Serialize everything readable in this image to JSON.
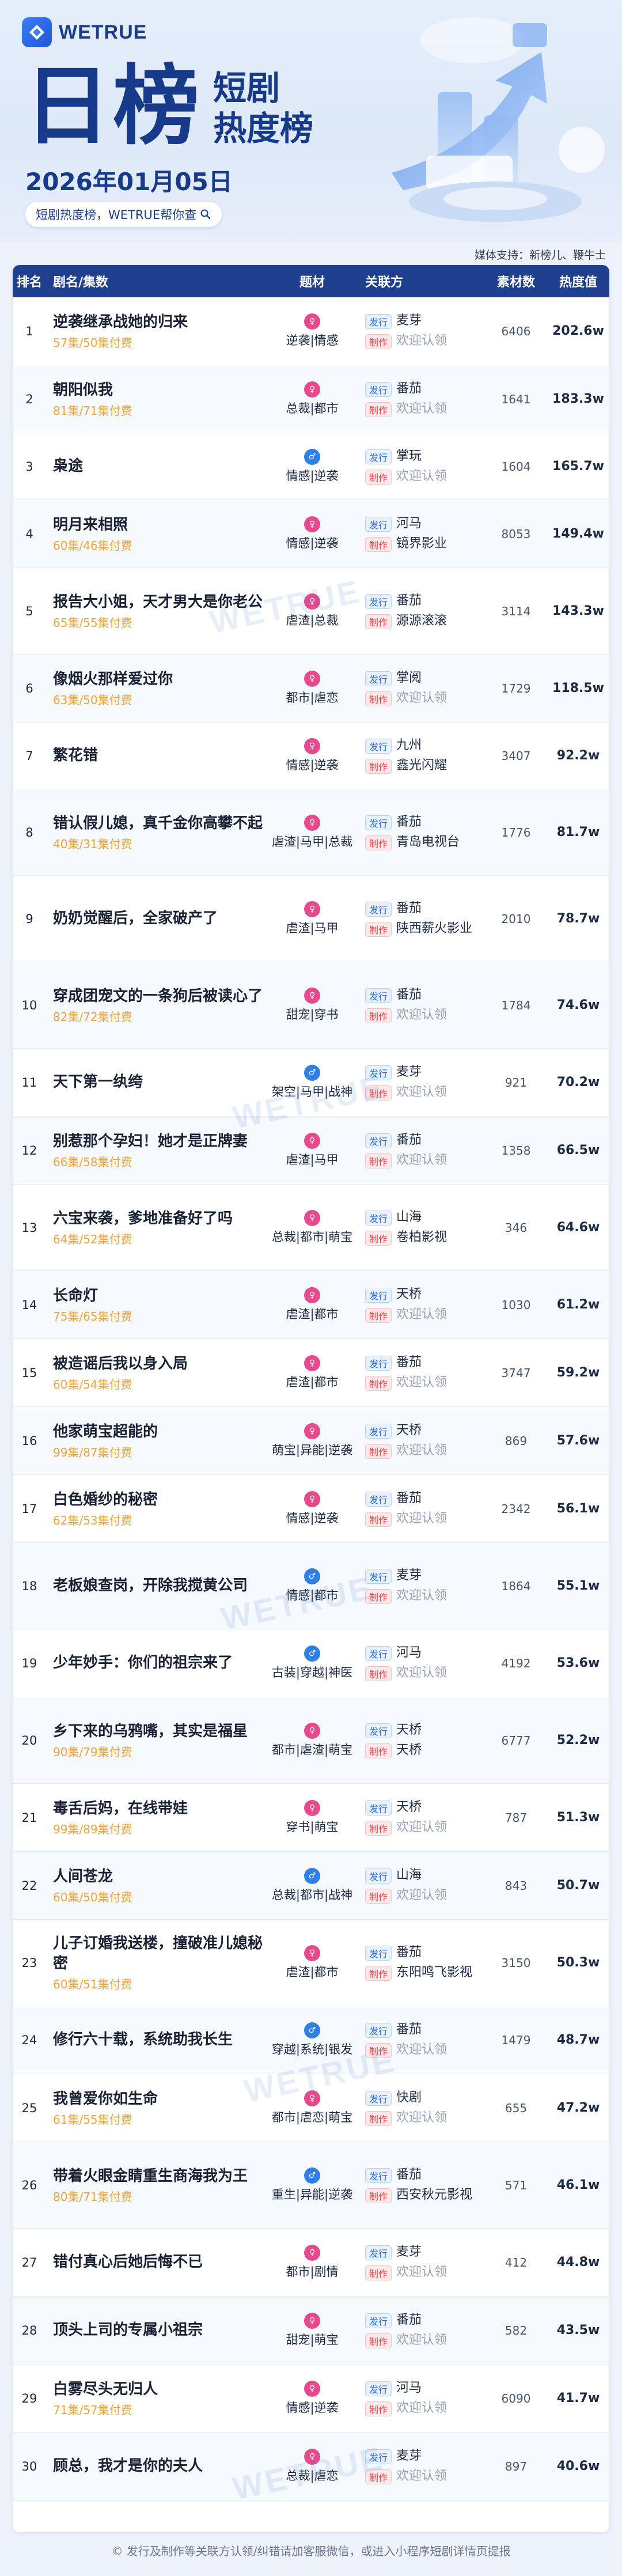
{
  "brand": "WETRUE",
  "header": {
    "title": "日榜",
    "side_line1": "短剧",
    "side_line2": "热度榜",
    "date": "2026年01月05日",
    "slogan": "短剧热度榜，WETRUE帮你查"
  },
  "sponsor": "媒体支持：新榜儿、鞭牛士",
  "columns": {
    "rank": "排名",
    "title": "剧名/集数",
    "tag": "题材",
    "assoc": "关联方",
    "num": "素材数",
    "heat": "热度值"
  },
  "badges": {
    "publish": "发行",
    "produce": "制作"
  },
  "watermark": "WETRUE",
  "colors": {
    "header_bg": "#1f3f8f",
    "accent": "#2f6fe3",
    "episode": "#f2a33a",
    "produce_badge": "#e5484d"
  },
  "rows": [
    {
      "rank": "1",
      "name": "逆袭继承战她的归来",
      "ep": "57集/50集付费",
      "tag": "逆袭|情感",
      "icon": "pink",
      "publish": "麦芽",
      "produce": "欢迎认领",
      "claim": true,
      "num": "6406",
      "heat": "202.6w"
    },
    {
      "rank": "2",
      "name": "朝阳似我",
      "ep": "81集/71集付费",
      "tag": "总裁|都市",
      "icon": "pink",
      "publish": "番茄",
      "produce": "欢迎认领",
      "claim": true,
      "num": "1641",
      "heat": "183.3w"
    },
    {
      "rank": "3",
      "name": "枭途",
      "ep": "",
      "tag": "情感|逆袭",
      "icon": "blue",
      "publish": "掌玩",
      "produce": "欢迎认领",
      "claim": true,
      "num": "1604",
      "heat": "165.7w"
    },
    {
      "rank": "4",
      "name": "明月来相照",
      "ep": "60集/46集付费",
      "tag": "情感|逆袭",
      "icon": "pink",
      "publish": "河马",
      "produce": "镜界影业",
      "claim": false,
      "num": "8053",
      "heat": "149.4w"
    },
    {
      "rank": "5",
      "name": "报告大小姐，天才男大是你老公",
      "ep": "65集/55集付费",
      "tag": "虐渣|总裁",
      "icon": "pink",
      "publish": "番茄",
      "produce": "源源滚滚",
      "claim": false,
      "num": "3114",
      "heat": "143.3w"
    },
    {
      "rank": "6",
      "name": "像烟火那样爱过你",
      "ep": "63集/50集付费",
      "tag": "都市|虐恋",
      "icon": "pink",
      "publish": "掌阅",
      "produce": "欢迎认领",
      "claim": true,
      "num": "1729",
      "heat": "118.5w"
    },
    {
      "rank": "7",
      "name": "繁花错",
      "ep": "",
      "tag": "情感|逆袭",
      "icon": "pink",
      "publish": "九州",
      "produce": "鑫光闪耀",
      "claim": false,
      "num": "3407",
      "heat": "92.2w"
    },
    {
      "rank": "8",
      "name": "错认假儿媳，真千金你高攀不起",
      "ep": "40集/31集付费",
      "tag": "虐渣|马甲|总裁",
      "icon": "pink",
      "publish": "番茄",
      "produce": "青岛电视台",
      "claim": false,
      "num": "1776",
      "heat": "81.7w"
    },
    {
      "rank": "9",
      "name": "奶奶觉醒后，全家破产了",
      "ep": "",
      "tag": "虐渣|马甲",
      "icon": "pink",
      "publish": "番茄",
      "produce": "陕西薪火影业",
      "claim": false,
      "num": "2010",
      "heat": "78.7w"
    },
    {
      "rank": "10",
      "name": "穿成团宠文的一条狗后被读心了",
      "ep": "82集/72集付费",
      "tag": "甜宠|穿书",
      "icon": "pink",
      "publish": "番茄",
      "produce": "欢迎认领",
      "claim": true,
      "num": "1784",
      "heat": "74.6w"
    },
    {
      "rank": "11",
      "name": "天下第一纨绔",
      "ep": "",
      "tag": "架空|马甲|战神",
      "icon": "blue",
      "publish": "麦芽",
      "produce": "欢迎认领",
      "claim": true,
      "num": "921",
      "heat": "70.2w"
    },
    {
      "rank": "12",
      "name": "别惹那个孕妇！她才是正牌妻",
      "ep": "66集/58集付费",
      "tag": "虐渣|马甲",
      "icon": "pink",
      "publish": "番茄",
      "produce": "欢迎认领",
      "claim": true,
      "num": "1358",
      "heat": "66.5w"
    },
    {
      "rank": "13",
      "name": "六宝来袭，爹地准备好了吗",
      "ep": "64集/52集付费",
      "tag": "总裁|都市|萌宝",
      "icon": "pink",
      "publish": "山海",
      "produce": "卷柏影视",
      "claim": false,
      "num": "346",
      "heat": "64.6w"
    },
    {
      "rank": "14",
      "name": "长命灯",
      "ep": "75集/65集付费",
      "tag": "虐渣|都市",
      "icon": "pink",
      "publish": "天桥",
      "produce": "欢迎认领",
      "claim": true,
      "num": "1030",
      "heat": "61.2w"
    },
    {
      "rank": "15",
      "name": "被造谣后我以身入局",
      "ep": "60集/54集付费",
      "tag": "虐渣|都市",
      "icon": "pink",
      "publish": "番茄",
      "produce": "欢迎认领",
      "claim": true,
      "num": "3747",
      "heat": "59.2w"
    },
    {
      "rank": "16",
      "name": "他家萌宝超能的",
      "ep": "99集/87集付费",
      "tag": "萌宝|异能|逆袭",
      "icon": "pink",
      "publish": "天桥",
      "produce": "欢迎认领",
      "claim": true,
      "num": "869",
      "heat": "57.6w"
    },
    {
      "rank": "17",
      "name": "白色婚纱的秘密",
      "ep": "62集/53集付费",
      "tag": "情感|逆袭",
      "icon": "pink",
      "publish": "番茄",
      "produce": "欢迎认领",
      "claim": true,
      "num": "2342",
      "heat": "56.1w"
    },
    {
      "rank": "18",
      "name": "老板娘查岗，开除我搅黄公司",
      "ep": "",
      "tag": "情感|都市",
      "icon": "blue",
      "publish": "麦芽",
      "produce": "欢迎认领",
      "claim": true,
      "num": "1864",
      "heat": "55.1w"
    },
    {
      "rank": "19",
      "name": "少年妙手：你们的祖宗来了",
      "ep": "",
      "tag": "古装|穿越|神医",
      "icon": "blue",
      "publish": "河马",
      "produce": "欢迎认领",
      "claim": true,
      "num": "4192",
      "heat": "53.6w"
    },
    {
      "rank": "20",
      "name": "乡下来的乌鸦嘴，其实是福星",
      "ep": "90集/79集付费",
      "tag": "都市|虐渣|萌宝",
      "icon": "pink",
      "publish": "天桥",
      "produce": "天桥",
      "claim": false,
      "num": "6777",
      "heat": "52.2w"
    },
    {
      "rank": "21",
      "name": "毒舌后妈，在线带娃",
      "ep": "99集/89集付费",
      "tag": "穿书|萌宝",
      "icon": "pink",
      "publish": "天桥",
      "produce": "欢迎认领",
      "claim": true,
      "num": "787",
      "heat": "51.3w"
    },
    {
      "rank": "22",
      "name": "人间苍龙",
      "ep": "60集/50集付费",
      "tag": "总裁|都市|战神",
      "icon": "blue",
      "publish": "山海",
      "produce": "欢迎认领",
      "claim": true,
      "num": "843",
      "heat": "50.7w"
    },
    {
      "rank": "23",
      "name": "儿子订婚我送楼，撞破准儿媳秘密",
      "ep": "60集/51集付费",
      "tag": "虐渣|都市",
      "icon": "pink",
      "publish": "番茄",
      "produce": "东阳鸣飞影视",
      "claim": false,
      "num": "3150",
      "heat": "50.3w"
    },
    {
      "rank": "24",
      "name": "修行六十载，系统助我长生",
      "ep": "",
      "tag": "穿越|系统|银发",
      "icon": "blue",
      "publish": "番茄",
      "produce": "欢迎认领",
      "claim": true,
      "num": "1479",
      "heat": "48.7w"
    },
    {
      "rank": "25",
      "name": "我曾爱你如生命",
      "ep": "61集/55集付费",
      "tag": "都市|虐恋|萌宝",
      "icon": "pink",
      "publish": "快剧",
      "produce": "欢迎认领",
      "claim": true,
      "num": "655",
      "heat": "47.2w"
    },
    {
      "rank": "26",
      "name": "带着火眼金睛重生商海我为王",
      "ep": "80集/71集付费",
      "tag": "重生|异能|逆袭",
      "icon": "blue",
      "publish": "番茄",
      "produce": "西安秋元影视",
      "claim": false,
      "num": "571",
      "heat": "46.1w"
    },
    {
      "rank": "27",
      "name": "错付真心后她后悔不已",
      "ep": "",
      "tag": "都市|剧情",
      "icon": "pink",
      "publish": "麦芽",
      "produce": "欢迎认领",
      "claim": true,
      "num": "412",
      "heat": "44.8w"
    },
    {
      "rank": "28",
      "name": "顶头上司的专属小祖宗",
      "ep": "",
      "tag": "甜宠|萌宝",
      "icon": "pink",
      "publish": "番茄",
      "produce": "欢迎认领",
      "claim": true,
      "num": "582",
      "heat": "43.5w"
    },
    {
      "rank": "29",
      "name": "白雾尽头无归人",
      "ep": "71集/57集付费",
      "tag": "情感|逆袭",
      "icon": "pink",
      "publish": "河马",
      "produce": "欢迎认领",
      "claim": true,
      "num": "6090",
      "heat": "41.7w"
    },
    {
      "rank": "30",
      "name": "顾总，我才是你的夫人",
      "ep": "",
      "tag": "总裁|虐恋",
      "icon": "pink",
      "publish": "麦芽",
      "produce": "欢迎认领",
      "claim": true,
      "num": "897",
      "heat": "40.6w"
    }
  ],
  "footer": "© 发行及制作等关联方认领/纠错请加客服微信，或进入小程序短剧详情页提报"
}
